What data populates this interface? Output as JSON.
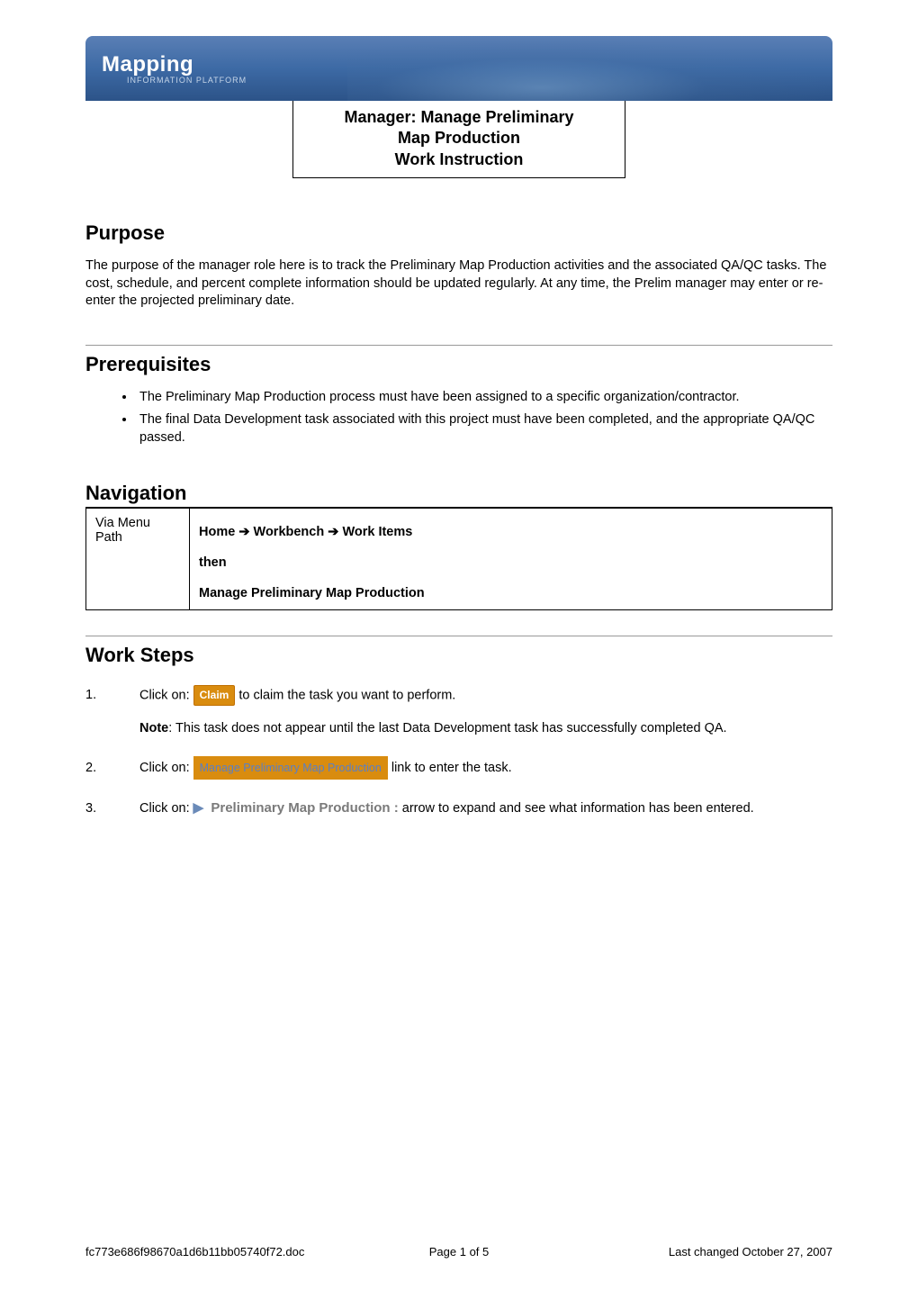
{
  "header": {
    "logo": "Mapping",
    "logo_sub": "INFORMATION PLATFORM"
  },
  "title_box": {
    "line1": "Manager: Manage Preliminary",
    "line2": "Map Production",
    "line3": "Work Instruction"
  },
  "sections": {
    "purpose": {
      "heading": "Purpose",
      "body": "The purpose of the manager role here is to track the Preliminary Map Production activities and the associated QA/QC tasks.  The cost, schedule, and percent complete information should be updated regularly.  At any time, the Prelim manager may enter or re-enter the projected preliminary date."
    },
    "prereq": {
      "heading": "Prerequisites",
      "items": [
        "The Preliminary Map Production process must have been assigned to a specific organization/contractor.",
        "The final Data Development task associated with this project must have been completed, and the appropriate QA/QC passed."
      ]
    },
    "navigation": {
      "heading": "Navigation",
      "label": "Via Menu Path",
      "path_parts": [
        "Home",
        "Workbench",
        "Work Items"
      ],
      "then": "then",
      "action": "Manage Preliminary Map Production"
    },
    "work_steps": {
      "heading": "Work Steps",
      "steps": [
        {
          "num": "1.",
          "prefix": "Click on: ",
          "btn": "Claim",
          "suffix": " to claim the task you want to perform."
        },
        {
          "num": "2.",
          "prefix": "Click on: ",
          "link": "Manage Preliminary Map Production",
          "suffix": " link to enter the task."
        },
        {
          "num": "3.",
          "prefix": "Click on: ",
          "expand": "Preliminary Map Production :",
          "suffix": " arrow to expand and see what information has been entered."
        }
      ],
      "note_bold": "Note",
      "note_text": ": This task does not appear until the last Data Development task has successfully completed QA."
    }
  },
  "footer": {
    "left": "fc773e686f98670a1d6b11bb05740f72.doc",
    "center_prefix": "Page ",
    "center_page": "1",
    "center_of": " of ",
    "center_total": "5",
    "right": "Last changed October 27, 2007"
  }
}
